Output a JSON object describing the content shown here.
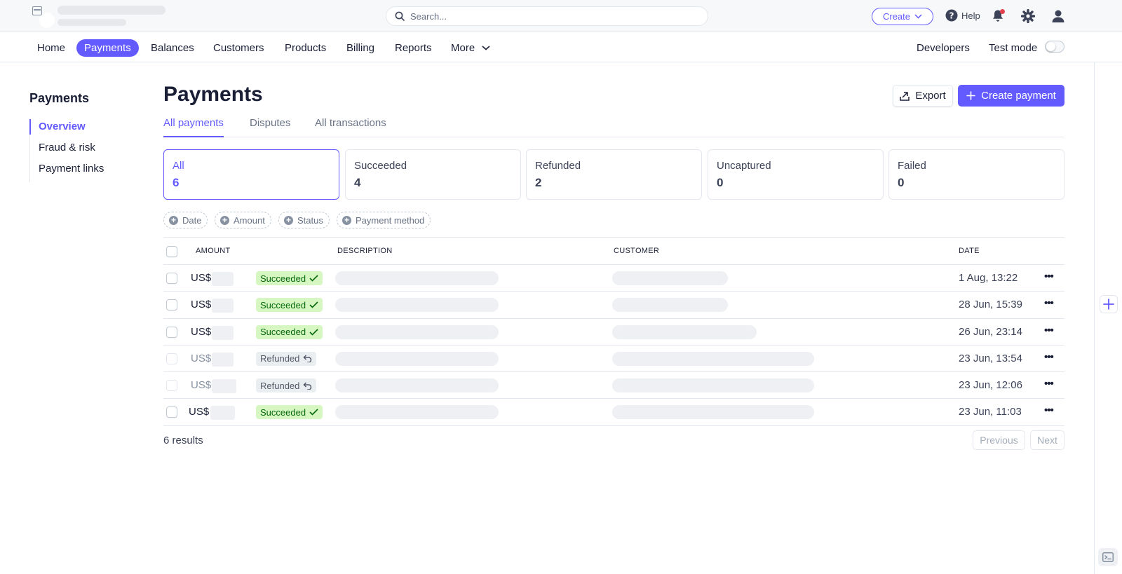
{
  "topbar": {
    "search_placeholder": "Search...",
    "create_label": "Create",
    "help_label": "Help"
  },
  "nav": {
    "items": [
      "Home",
      "Payments",
      "Balances",
      "Customers",
      "Products",
      "Billing",
      "Reports",
      "More"
    ],
    "active": "Payments",
    "developers_label": "Developers",
    "test_mode_label": "Test mode",
    "test_mode_on": false
  },
  "sidebar": {
    "title": "Payments",
    "items": [
      "Overview",
      "Fraud & risk",
      "Payment links"
    ],
    "active": "Overview"
  },
  "page": {
    "title": "Payments",
    "export_label": "Export",
    "create_payment_label": "Create payment",
    "tabs": [
      "All payments",
      "Disputes",
      "All transactions"
    ],
    "active_tab": "All payments"
  },
  "status_cards": [
    {
      "label": "All",
      "count": "6"
    },
    {
      "label": "Succeeded",
      "count": "4"
    },
    {
      "label": "Refunded",
      "count": "2"
    },
    {
      "label": "Uncaptured",
      "count": "0"
    },
    {
      "label": "Failed",
      "count": "0"
    }
  ],
  "filters": [
    "Date",
    "Amount",
    "Status",
    "Payment method"
  ],
  "table": {
    "headers": {
      "amount": "AMOUNT",
      "description": "DESCRIPTION",
      "customer": "CUSTOMER",
      "date": "DATE"
    },
    "rows": [
      {
        "currency": "US$",
        "status": "Succeeded",
        "date": "1 Aug, 13:22"
      },
      {
        "currency": "US$",
        "status": "Succeeded",
        "date": "28 Jun, 15:39"
      },
      {
        "currency": "US$",
        "status": "Succeeded",
        "date": "26 Jun, 23:14"
      },
      {
        "currency": "US$",
        "status": "Refunded",
        "date": "23 Jun, 13:54"
      },
      {
        "currency": "US$",
        "status": "Refunded",
        "date": "23 Jun, 12:06"
      },
      {
        "currency": "US$",
        "status": "Succeeded",
        "date": "23 Jun, 11:03"
      }
    ]
  },
  "footer": {
    "results": "6 results",
    "previous_label": "Previous",
    "next_label": "Next"
  },
  "colors": {
    "accent": "#635bff",
    "success_bg": "#d7f7c2",
    "success_text": "#05690d",
    "refund_bg": "#ebeef1"
  },
  "icons": [
    "search-icon",
    "chevron-down-icon",
    "help-icon",
    "bell-icon",
    "gear-icon",
    "user-icon",
    "export-icon",
    "plus-icon",
    "check-icon",
    "refund-arrow-icon",
    "more-dots-icon",
    "terminal-icon"
  ]
}
